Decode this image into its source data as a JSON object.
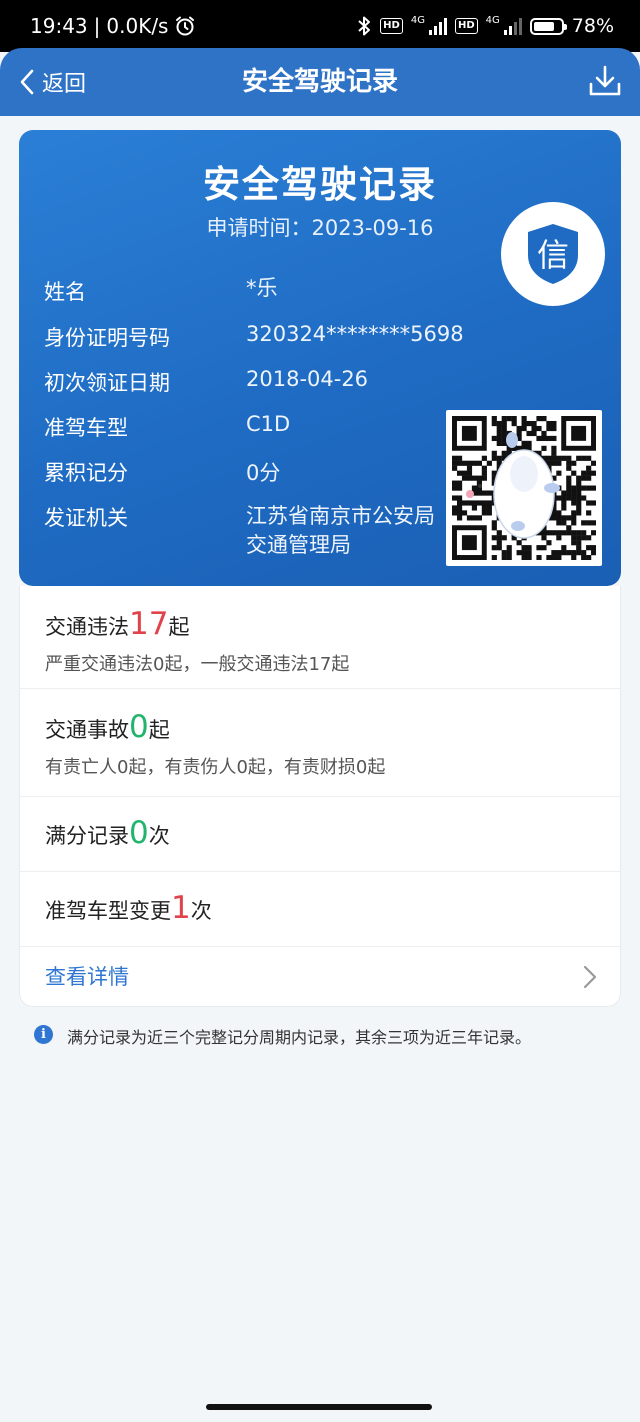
{
  "status_bar": {
    "time": "19:43",
    "speed": "0.0K/s",
    "network_1": "4G",
    "network_2": "4G",
    "hd_1": "HD",
    "hd_2": "HD",
    "battery": "78%",
    "battery_level": 0.78
  },
  "nav": {
    "back_label": "返回",
    "title": "安全驾驶记录"
  },
  "card": {
    "title": "安全驾驶记录",
    "apply_time": "申请时间：2023-09-16",
    "badge_char": "信",
    "fields": [
      {
        "label": "姓名",
        "value": "*乐"
      },
      {
        "label": "身份证明号码",
        "value": "320324********5698"
      },
      {
        "label": "初次领证日期",
        "value": "2018-04-26"
      },
      {
        "label": "准驾车型",
        "value": "C1D"
      },
      {
        "label": "累积记分",
        "value": "0分"
      },
      {
        "label": "发证机关",
        "value": "江苏省南京市公安局交通管理局"
      }
    ]
  },
  "stats": {
    "violations": {
      "prefix": "交通违法",
      "count": "17",
      "suffix": "起",
      "detail": "严重交通违法0起，一般交通违法17起"
    },
    "accidents": {
      "prefix": "交通事故",
      "count": "0",
      "suffix": "起",
      "detail": "有责亡人0起，有责伤人0起，有责财损0起"
    },
    "full_score": {
      "prefix": "满分记录",
      "count": "0",
      "suffix": "次"
    },
    "class_change": {
      "prefix": "准驾车型变更",
      "count": "1",
      "suffix": "次"
    },
    "details_link": "查看详情"
  },
  "note": {
    "icon": "i",
    "text": "满分记录为近三个完整记分周期内记录，其余三项为近三年记录。"
  },
  "colors": {
    "nav_blue": "#2f73c7",
    "card_blue": "#1f6bc3",
    "red": "#e0434b",
    "green": "#22b46d",
    "link_blue": "#2e76d1"
  }
}
